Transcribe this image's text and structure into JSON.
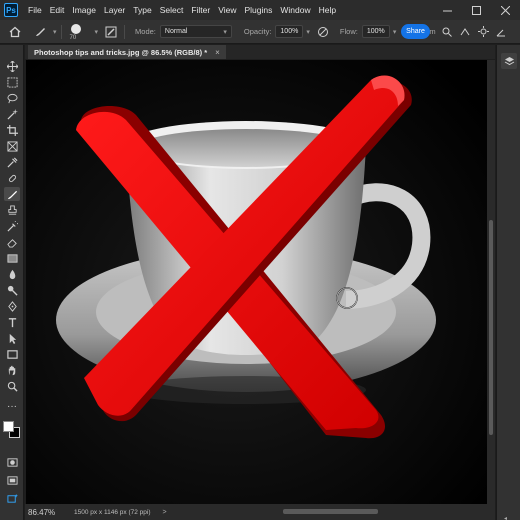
{
  "app": {
    "logo_text": "Ps",
    "menu": [
      "File",
      "Edit",
      "Image",
      "Layer",
      "Type",
      "Select",
      "Filter",
      "View",
      "Plugins",
      "Window",
      "Help"
    ]
  },
  "options_bar": {
    "brush_size": "70",
    "mode_label": "Mode:",
    "mode_value": "Normal",
    "opacity_label": "Opacity:",
    "opacity_value": "100%",
    "flow_label": "Flow:",
    "flow_value": "100%",
    "share_label": "Share",
    "smoothing_partial": "Sm"
  },
  "document": {
    "tab_title": "Photoshop tips and tricks.jpg @ 86.5% (RGB/8) *",
    "close_glyph": "×"
  },
  "status": {
    "zoom": "86.47%",
    "doc_info": "1500 px x 1146 px (72 ppi)",
    "arrow": ">"
  },
  "colors": {
    "accent": "#1473e6",
    "foreground_swatch": "#ffffff",
    "background_swatch": "#000000",
    "x_mark": "#e00000"
  },
  "icons": [
    "home-icon",
    "brush-icon",
    "brush-settings-icon",
    "airbrush-icon",
    "pressure-icon",
    "layers-icon"
  ]
}
